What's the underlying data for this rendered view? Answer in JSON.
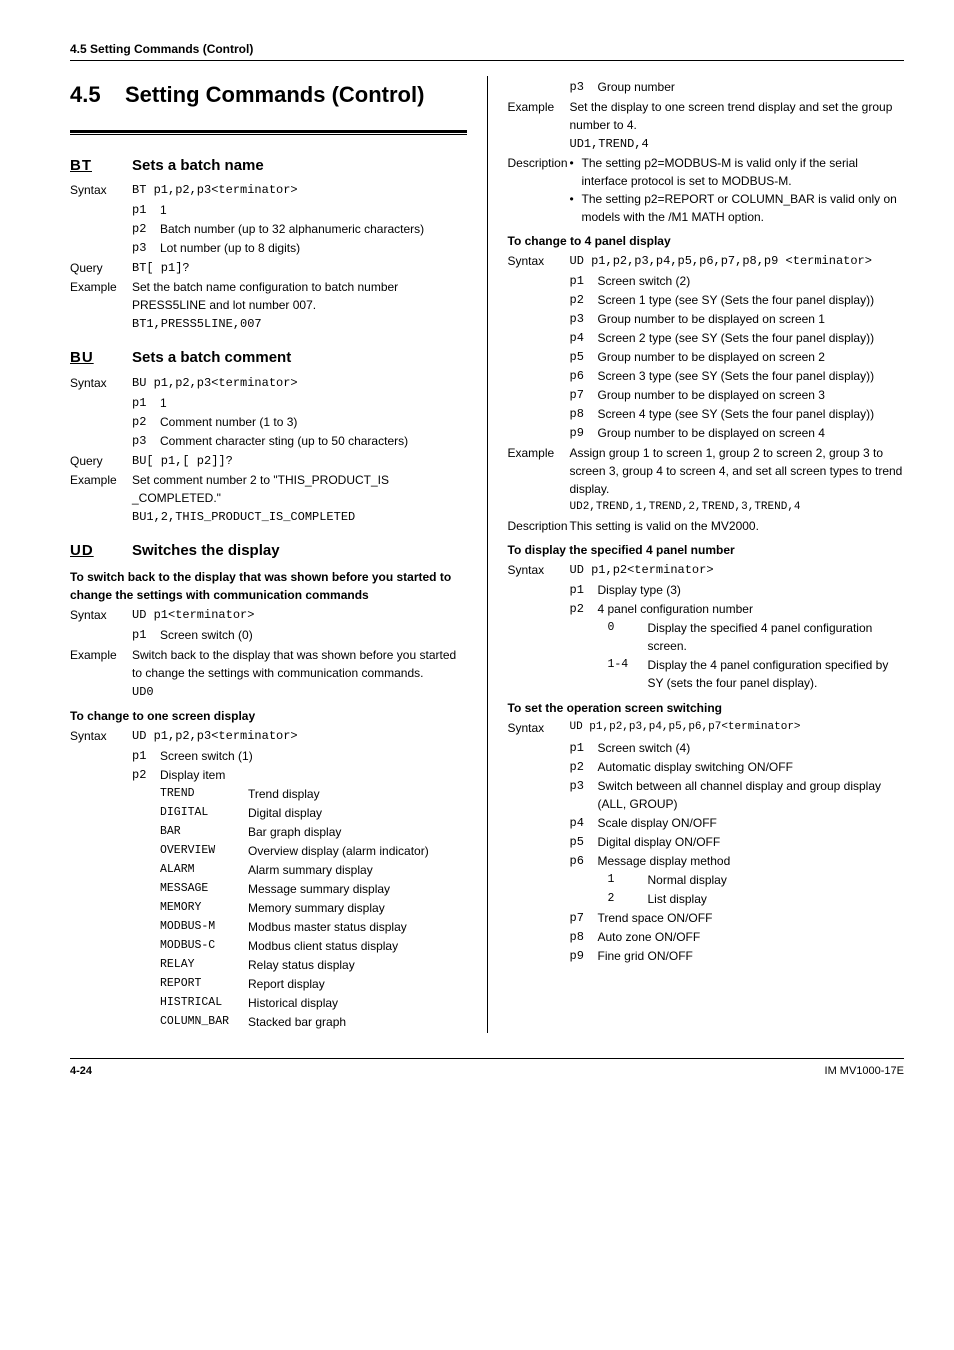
{
  "header": "4.5  Setting Commands (Control)",
  "chapter": {
    "num": "4.5",
    "title": "Setting Commands (Control)"
  },
  "bt": {
    "code": "BT",
    "title": "Sets a batch name",
    "syntax": "BT p1,p2,p3<terminator>",
    "p1": "1",
    "p2": "Batch number (up to 32 alphanumeric characters)",
    "p3": "Lot number (up to 8 digits)",
    "query": "BT[ p1]?",
    "example_text": "Set the batch name configuration to batch number PRESS5LINE and lot number 007.",
    "example_code": "BT1,PRESS5LINE,007"
  },
  "bu": {
    "code": "BU",
    "title": "Sets a batch comment",
    "syntax": "BU p1,p2,p3<terminator>",
    "p1": "1",
    "p2": "Comment number (1 to 3)",
    "p3": "Comment character sting (up to 50 characters)",
    "query": "BU[ p1,[ p2]]?",
    "example_text": "Set comment number 2 to \"THIS_PRODUCT_IS _COMPLETED.\"",
    "example_code": "BU1,2,THIS_PRODUCT_IS_COMPLETED"
  },
  "ud": {
    "code": "UD",
    "title": "Switches the display",
    "switch_back": {
      "heading": "To switch back to the display that was shown before you started to change the settings with communication commands",
      "syntax": "UD p1<terminator>",
      "p1": "Screen switch (0)",
      "example_text": "Switch back to the display that was shown before you started to change the settings with communication commands.",
      "example_code": "UD0"
    },
    "one_screen": {
      "heading": "To change to one screen display",
      "syntax": "UD p1,p2,p3<terminator>",
      "p1": "Screen switch (1)",
      "p2": "Display item",
      "items": [
        {
          "k": "TREND",
          "v": "Trend display"
        },
        {
          "k": "DIGITAL",
          "v": "Digital display"
        },
        {
          "k": "BAR",
          "v": "Bar graph display"
        },
        {
          "k": "OVERVIEW",
          "v": "Overview display (alarm indicator)"
        },
        {
          "k": "ALARM",
          "v": "Alarm summary display"
        },
        {
          "k": "MESSAGE",
          "v": "Message summary display"
        },
        {
          "k": "MEMORY",
          "v": "Memory summary display"
        },
        {
          "k": "MODBUS-M",
          "v": "Modbus master status display"
        },
        {
          "k": "MODBUS-C",
          "v": "Modbus client status display"
        },
        {
          "k": "RELAY",
          "v": "Relay status display"
        },
        {
          "k": "REPORT",
          "v": "Report display"
        },
        {
          "k": "HISTRICAL",
          "v": "Historical display"
        },
        {
          "k": "COLUMN_BAR",
          "v": "Stacked bar graph"
        }
      ],
      "p3": "Group number",
      "example_text": "Set the display to one screen trend display and set the group number to 4.",
      "example_code": "UD1,TREND,4",
      "desc1": "The setting p2=MODBUS-M is valid only if the serial interface protocol is set to MODBUS-M.",
      "desc2": "The setting p2=REPORT or COLUMN_BAR is valid only on models with the /M1 MATH option."
    },
    "four_panel": {
      "heading": "To change to 4 panel display",
      "syntax": "UD p1,p2,p3,p4,p5,p6,p7,p8,p9 <terminator>",
      "p1": "Screen switch (2)",
      "p2": "Screen 1 type (see SY (Sets the four panel display))",
      "p3": "Group number to be displayed on screen 1",
      "p4": "Screen 2 type (see SY (Sets the four panel display))",
      "p5": "Group number to be displayed on screen 2",
      "p6": "Screen 3 type (see SY (Sets the four panel display))",
      "p7": "Group number to be displayed on screen 3",
      "p8": "Screen 4 type (see SY (Sets the four panel display))",
      "p9": "Group number to be displayed on screen 4",
      "example_text": "Assign group 1 to screen 1, group 2 to screen 2, group 3 to screen 3, group 4 to screen 4, and set all screen types to trend display.",
      "example_code": "UD2,TREND,1,TREND,2,TREND,3,TREND,4",
      "desc": "This setting is valid on the MV2000."
    },
    "four_panel_num": {
      "heading": "To display the specified 4 panel number",
      "syntax": "UD p1,p2<terminator>",
      "p1": "Display type (3)",
      "p2": "4 panel configuration number",
      "opt0": "Display the specified 4 panel configuration screen.",
      "opt14": "Display the 4 panel configuration specified by SY (sets the four panel display)."
    },
    "op_switch": {
      "heading": "To set the operation screen switching",
      "syntax": "UD  p1,p2,p3,p4,p5,p6,p7<terminator>",
      "p1": "Screen switch (4)",
      "p2": "Automatic display switching ON/OFF",
      "p3": "Switch between all channel display and group display (ALL, GROUP)",
      "p4": "Scale display ON/OFF",
      "p5": "Digital display ON/OFF",
      "p6": "Message display method",
      "p6_1": "Normal display",
      "p6_2": "List display",
      "p7": "Trend space ON/OFF",
      "p8": "Auto zone ON/OFF",
      "p9": "Fine grid ON/OFF"
    }
  },
  "labels": {
    "syntax": "Syntax",
    "query": "Query",
    "example": "Example",
    "description": "Description"
  },
  "footer": {
    "left": "4-24",
    "right": "IM MV1000-17E"
  }
}
